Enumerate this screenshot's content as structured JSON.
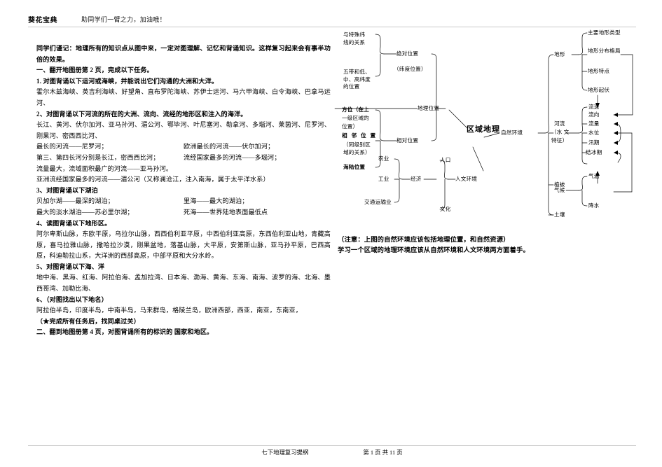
{
  "header": {
    "title": "葵花宝典",
    "subtitle": "助同学们一臂之力，加油哦！"
  },
  "left": {
    "intro": "同学们谨记：地理所有的知识点从图中来，一定对图理解、记忆和背诵知识。这样复习起来会有事半功倍的效果。",
    "section_one_title": "一、翻开地图册第 2 页，完成以下任务。",
    "task1_title": "1. 对图背诵以下运河或海峡，并能说出它们沟通的大洲和大洋。",
    "task1_body": "霍尔木兹海峡、英吉利海峡、好望角、直布罗陀海峡、苏伊士运河、马六甲海峡、白令海峡、巴拿马运河、",
    "task2_title": "2、对图背诵以下河流的所在的大洲、流向、流经的地形区和注入的海洋。",
    "task2_body": "长江、黄河、伏尔加河、亚马孙河、湄公河、鄂毕河、叶尼塞河、勒拿河、多瑙河、莱茵河、尼罗河、刚果河、密西西比河、",
    "task2_rows": [
      {
        "left": "最长的河流——尼罗河；",
        "right": "欧洲最长的河流——伏尔加河；"
      },
      {
        "left": "第三、第四长河分别是长江，密西西比河；",
        "right": "流经国家最多的河流——多瑙河；"
      }
    ],
    "task2_extra1": "流量最大，流域面积最广的河流——亚马孙河。",
    "task2_extra2": "亚洲流经国家最多的河流——湄公河（又称澜沧江，注入南海，属于太平洋水系）",
    "task3_title": "3、对图背诵以下湖泊",
    "task3_rows": [
      {
        "left": "贝加尔湖——最深的湖泊；",
        "right": "里海——最大的湖泊；"
      },
      {
        "left": "最大的淡水湖泊——苏必里尔湖；",
        "right": "死海——世界陆地表面最低点"
      }
    ],
    "task4_title": "4、读图背诵以下地形区。",
    "task4_body": "阿尔卑斯山脉，东欧平原，乌拉尔山脉，西西伯利亚平原，中西伯利亚高原，东西伯利亚山地，青藏高原，喜马拉雅山脉，撒哈拉沙漠，刚果盆地，落基山脉，大平原，安第斯山脉，亚马孙平原，巴西高原，科迪勒拉山系，大洋洲的西部高原，中部平原和大分水岭。",
    "task5_title": "5、对图背诵以下海、洋",
    "task5_body": "地中海、黑海、红海、阿拉伯海、孟加拉湾、日本海、渤海、黄海、东海、南海、波罗的海、北海、墨西哥湾、加勒比海、",
    "task6_title": "6、（对图找出以下地名）",
    "task6_body": "阿拉伯半岛，印度半岛，中南半岛，马来群岛，格陵兰岛，欧洲西部，西亚，南亚，东南亚，",
    "task6_note": "（★完成所有任务后，找同桌过关）",
    "section_two_title": "二、翻到地图册第 4 页，对图背诵所有的标识的 国家和地区。"
  },
  "diagram": {
    "center": "区域地理",
    "geo_position": "地理位置",
    "absolute_position": "绝对位置",
    "absolute_position_sub": "（纬度位置）",
    "relative_position": "相对位置",
    "special_latitude": "与特殊纬\n线的关系",
    "five_zones": "五带和低、\n中、高纬度\n的位置",
    "direction": "方位（在上",
    "direction_l2": "一级区域的",
    "direction_l3": "位置）",
    "adjacent": "相 邻 位 置",
    "adjacent_sub": "（同级别区\n域的关系）",
    "sea_land": "海陆位置",
    "natural_env": "自然环境",
    "human_env": "人文环境",
    "economy": "经济",
    "agriculture": "农业",
    "industry": "工业",
    "transport": "交通运输业",
    "population": "人口",
    "culture": "文化",
    "landform": "地形",
    "landform_children": [
      "主要地形类型",
      "地形分布格局",
      "地形特点",
      "地形起伏"
    ],
    "river": "河流",
    "river_l2": "（水 文",
    "river_l3": "特征）",
    "river_children": [
      "流速",
      "流向",
      "流量",
      "水位",
      "汛期",
      "结冰期"
    ],
    "climate": "气候",
    "climate_children": [
      "气温",
      "降水"
    ],
    "vegetation": "植被",
    "soil": "土壤"
  },
  "notes": {
    "line1": "（注意：上图的自然环境应该包括地理位置，和自然资源）",
    "line2": "学习一个区域的地理环境应该从自然环境和人文环境两方面着手。"
  },
  "footer": {
    "doc_title": "七下地理复习提纲",
    "page_info": "第 1 页 共 11 页"
  }
}
